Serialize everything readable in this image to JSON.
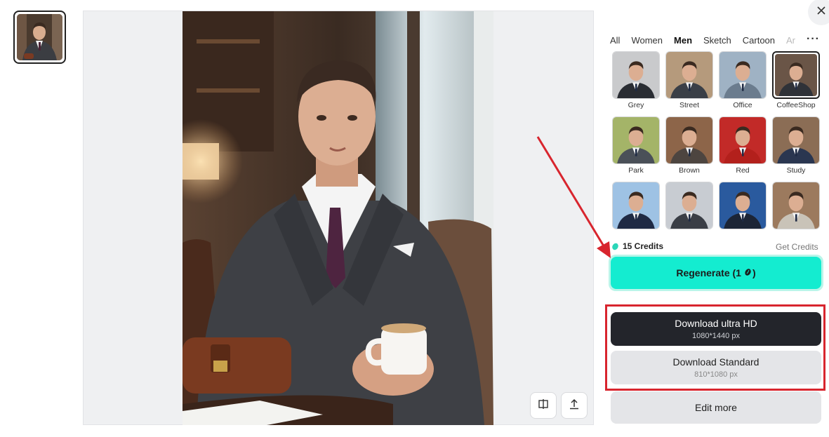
{
  "close": {
    "icon": "close-icon"
  },
  "canvas": {
    "compare_icon": "compare-icon",
    "upload_icon": "upload-icon"
  },
  "tabs": [
    {
      "label": "All",
      "active": false
    },
    {
      "label": "Women",
      "active": false
    },
    {
      "label": "Men",
      "active": true
    },
    {
      "label": "Sketch",
      "active": false
    },
    {
      "label": "Cartoon",
      "active": false
    },
    {
      "label": "Ar",
      "active": false
    }
  ],
  "tabs_more": "···",
  "styles": [
    {
      "label": "Grey",
      "bg": "#c9cacc",
      "suit": "#2a2d33",
      "selected": false
    },
    {
      "label": "Street",
      "bg": "#b59a7c",
      "suit": "#3a3f47",
      "selected": false
    },
    {
      "label": "Office",
      "bg": "#9fb2c4",
      "suit": "#6b7c8e",
      "selected": false
    },
    {
      "label": "CoffeeShop",
      "bg": "#6a5547",
      "suit": "#2f3238",
      "selected": true
    },
    {
      "label": "Park",
      "bg": "#a4b468",
      "suit": "#4a5058",
      "selected": false
    },
    {
      "label": "Brown",
      "bg": "#8d6549",
      "suit": "#4d4540",
      "selected": false
    },
    {
      "label": "Red",
      "bg": "#c22a28",
      "suit": "#b3201c",
      "selected": false
    },
    {
      "label": "Study",
      "bg": "#8b6d55",
      "suit": "#2a3650",
      "selected": false
    },
    {
      "label": "",
      "bg": "#9ec2e4",
      "suit": "#1f2a44",
      "selected": false
    },
    {
      "label": "",
      "bg": "#c8ccd2",
      "suit": "#3a3e46",
      "selected": false
    },
    {
      "label": "",
      "bg": "#2a5a9e",
      "suit": "#1c2536",
      "selected": false
    },
    {
      "label": "",
      "bg": "#9c7a5e",
      "suit": "#c9c3b8",
      "selected": false
    }
  ],
  "credits": {
    "text": "15 Credits",
    "get_label": "Get Credits"
  },
  "regenerate": {
    "label": "Regenerate (1",
    "suffix": ")"
  },
  "download_hd": {
    "label": "Download ultra HD",
    "size": "1080*1440 px"
  },
  "download_std": {
    "label": "Download Standard",
    "size": "810*1080 px"
  },
  "edit_more": {
    "label": "Edit more"
  },
  "colors": {
    "accent": "#14ecd0",
    "dark_button": "#23252b",
    "highlight_red": "#d8252e"
  }
}
